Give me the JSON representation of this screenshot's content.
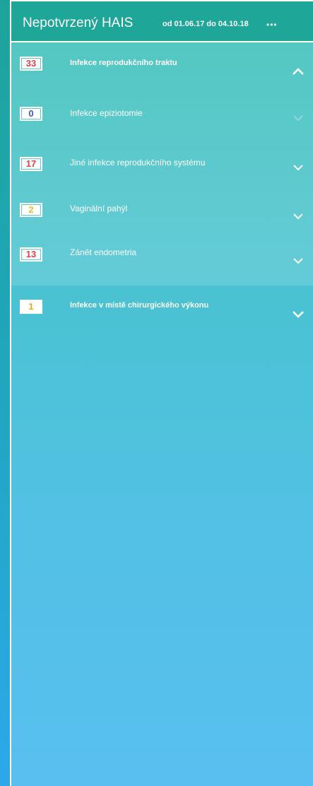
{
  "header": {
    "title": "Nepotvrzený HAIS",
    "range": "od 01.06.17 do 04.10.18",
    "menu_icon": "•••"
  },
  "groups": [
    {
      "count": "33",
      "count_color": "#e2424c",
      "label": "Infekce reprodukčního traktu",
      "expanded": true,
      "items": [
        {
          "count": "0",
          "count_color": "#3b5fb8",
          "label": "Infekce epiziotomie"
        },
        {
          "count": "17",
          "count_color": "#e2424c",
          "label": "Jiné infekce reprodukčního systému"
        },
        {
          "count": "2",
          "count_color": "#e2c23c",
          "label": "Vaginální pahýl"
        },
        {
          "count": "13",
          "count_color": "#e2424c",
          "label": "Zánět endometria"
        }
      ]
    },
    {
      "count": "1",
      "count_color": "#f0a818",
      "label": "Infekce v místě chirurgického výkonu",
      "expanded": false
    }
  ],
  "icons": {
    "collapse": "chevron-up-icon",
    "expand": "chevron-down-icon"
  }
}
